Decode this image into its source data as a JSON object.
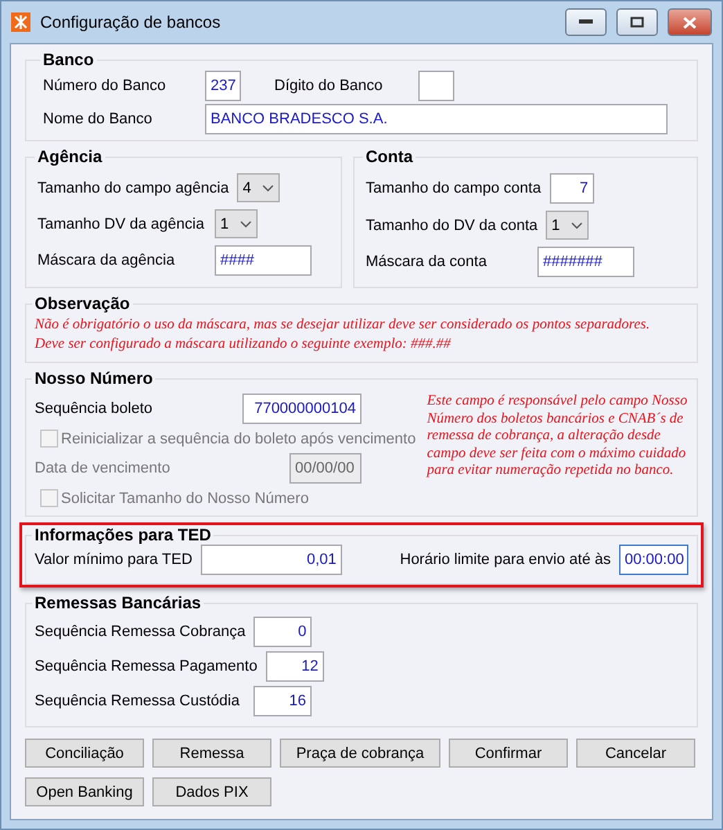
{
  "window": {
    "title": "Configuração de bancos"
  },
  "banco": {
    "title": "Banco",
    "numero": {
      "label": "Número do Banco",
      "value": "237"
    },
    "digito": {
      "label": "Dígito do Banco"
    },
    "nome": {
      "label": "Nome do Banco",
      "value": "BANCO BRADESCO S.A."
    }
  },
  "agencia": {
    "title": "Agência",
    "fields": [
      {
        "kind": "select",
        "label": "Tamanho do campo agência",
        "value": "4"
      },
      {
        "kind": "select",
        "label": "Tamanho DV da agência",
        "value": "1"
      },
      {
        "kind": "text",
        "label": "Máscara da agência",
        "value": "####"
      }
    ]
  },
  "conta": {
    "title": "Conta",
    "fields": [
      {
        "kind": "number",
        "label": "Tamanho do campo conta",
        "value": "7"
      },
      {
        "kind": "select",
        "label": "Tamanho do DV da conta",
        "value": "1"
      },
      {
        "kind": "text",
        "label": "Máscara da conta",
        "value": "#######"
      }
    ]
  },
  "observacao": {
    "title": "Observação",
    "lines": [
      "Não é obrigatório o uso da máscara, mas se desejar utilizar deve ser considerado os pontos separadores.",
      "Deve ser configurado a máscara utilizando o seguinte exemplo: ###.##"
    ]
  },
  "nosso_numero": {
    "title": "Nosso Número",
    "sequencia": {
      "label": "Sequência boleto",
      "value": "770000000104"
    },
    "reinicializar": {
      "label": "Reinicializar a sequência do boleto após vencimento",
      "checked": false,
      "disabled": true
    },
    "data_vencimento": {
      "label": "Data de vencimento",
      "value": "00/00/00",
      "disabled": true
    },
    "solicitar": {
      "label": "Solicitar Tamanho do Nosso Número",
      "checked": false,
      "disabled": true
    },
    "note": "Este campo é responsável pelo campo Nosso Número dos boletos bancários e CNAB´s de remessa de cobrança, a alteração desde campo deve ser feita com o máximo cuidado para evitar numeração repetida no banco."
  },
  "ted": {
    "title": "Informações para TED",
    "highlighted": true,
    "valor": {
      "label": "Valor mínimo para TED",
      "value": "0,01"
    },
    "horario": {
      "label": "Horário limite para envio até às",
      "value": "00:00:00",
      "focused": true
    }
  },
  "remessas": {
    "title": "Remessas Bancárias",
    "fields": [
      {
        "label": "Sequência Remessa Cobrança",
        "value": "0"
      },
      {
        "label": "Sequência Remessa Pagamento",
        "value": "12"
      },
      {
        "label": "Sequência Remessa Custódia",
        "value": "16"
      }
    ]
  },
  "buttons": [
    [
      "Conciliação",
      "Remessa",
      "Praça de cobrança",
      "Confirmar",
      "Cancelar"
    ],
    [
      "Open Banking",
      "Dados PIX"
    ]
  ]
}
